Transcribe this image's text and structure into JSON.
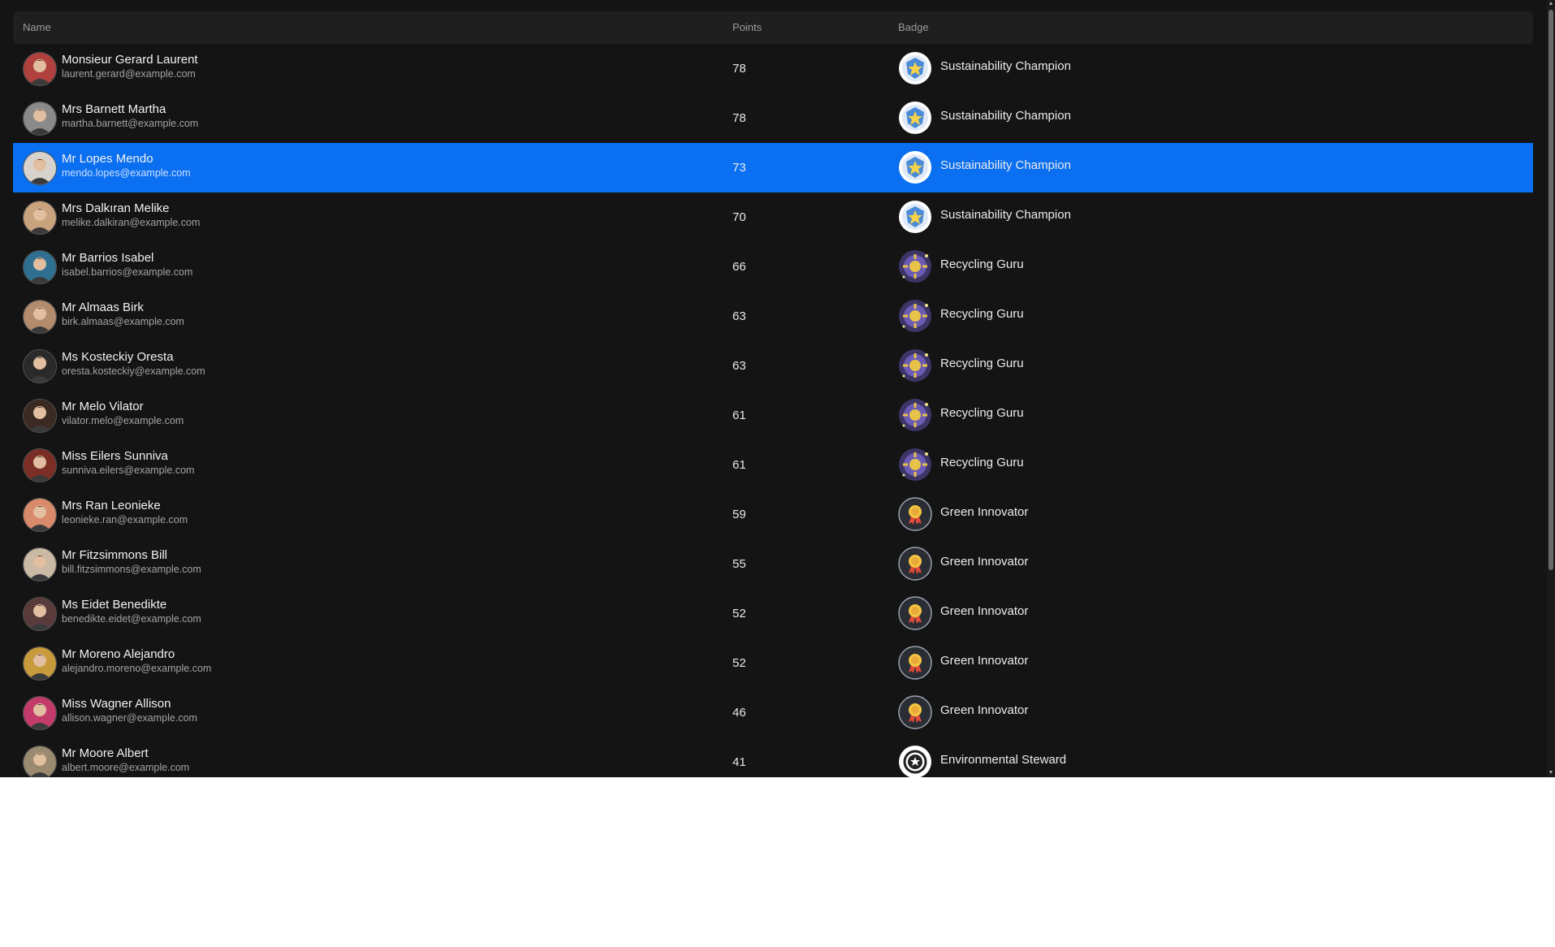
{
  "table": {
    "columns": {
      "name": "Name",
      "points": "Points",
      "badge": "Badge"
    },
    "selected_index": 2,
    "rows": [
      {
        "name": "Monsieur Gerard Laurent",
        "email": "laurent.gerard@example.com",
        "points": "78",
        "badge": "Sustainability Champion",
        "badge_icon": "shield-star-badge-icon",
        "avatar_color": "#b0413e"
      },
      {
        "name": "Mrs Barnett Martha",
        "email": "martha.barnett@example.com",
        "points": "78",
        "badge": "Sustainability Champion",
        "badge_icon": "shield-star-badge-icon",
        "avatar_color": "#8a8a8a"
      },
      {
        "name": "Mr Lopes Mendo",
        "email": "mendo.lopes@example.com",
        "points": "73",
        "badge": "Sustainability Champion",
        "badge_icon": "shield-star-badge-icon",
        "avatar_color": "#d8d2cc"
      },
      {
        "name": "Mrs Dalkıran Melike",
        "email": "melike.dalkiran@example.com",
        "points": "70",
        "badge": "Sustainability Champion",
        "badge_icon": "shield-star-badge-icon",
        "avatar_color": "#c9a27e"
      },
      {
        "name": "Mr Barrios Isabel",
        "email": "isabel.barrios@example.com",
        "points": "66",
        "badge": "Recycling Guru",
        "badge_icon": "purple-sun-badge-icon",
        "avatar_color": "#2f6f8f"
      },
      {
        "name": "Mr Almaas Birk",
        "email": "birk.almaas@example.com",
        "points": "63",
        "badge": "Recycling Guru",
        "badge_icon": "purple-sun-badge-icon",
        "avatar_color": "#b38b6d"
      },
      {
        "name": "Ms Kosteckiy Oresta",
        "email": "oresta.kosteckiy@example.com",
        "points": "63",
        "badge": "Recycling Guru",
        "badge_icon": "purple-sun-badge-icon",
        "avatar_color": "#2a2a2a"
      },
      {
        "name": "Mr Melo Vilator",
        "email": "vilator.melo@example.com",
        "points": "61",
        "badge": "Recycling Guru",
        "badge_icon": "purple-sun-badge-icon",
        "avatar_color": "#3b2a22"
      },
      {
        "name": "Miss Eilers Sunniva",
        "email": "sunniva.eilers@example.com",
        "points": "61",
        "badge": "Recycling Guru",
        "badge_icon": "purple-sun-badge-icon",
        "avatar_color": "#7a2e25"
      },
      {
        "name": "Mrs Ran Leonieke",
        "email": "leonieke.ran@example.com",
        "points": "59",
        "badge": "Green Innovator",
        "badge_icon": "ribbon-medal-badge-icon",
        "avatar_color": "#d98a6a"
      },
      {
        "name": "Mr Fitzsimmons Bill",
        "email": "bill.fitzsimmons@example.com",
        "points": "55",
        "badge": "Green Innovator",
        "badge_icon": "ribbon-medal-badge-icon",
        "avatar_color": "#c9b9a5"
      },
      {
        "name": "Ms Eidet Benedikte",
        "email": "benedikte.eidet@example.com",
        "points": "52",
        "badge": "Green Innovator",
        "badge_icon": "ribbon-medal-badge-icon",
        "avatar_color": "#5a3b3b"
      },
      {
        "name": "Mr Moreno Alejandro",
        "email": "alejandro.moreno@example.com",
        "points": "52",
        "badge": "Green Innovator",
        "badge_icon": "ribbon-medal-badge-icon",
        "avatar_color": "#c79a3c"
      },
      {
        "name": "Miss Wagner Allison",
        "email": "allison.wagner@example.com",
        "points": "46",
        "badge": "Green Innovator",
        "badge_icon": "ribbon-medal-badge-icon",
        "avatar_color": "#c23b6b"
      },
      {
        "name": "Mr Moore Albert",
        "email": "albert.moore@example.com",
        "points": "41",
        "badge": "Environmental Steward",
        "badge_icon": "gear-star-badge-icon",
        "avatar_color": "#9a8a70"
      }
    ]
  },
  "colors": {
    "background": "#141414",
    "header": "#1f1f1f",
    "selected": "#0a6ff0"
  },
  "scrollbar": {
    "up_arrow": "▲",
    "down_arrow": "▼"
  }
}
